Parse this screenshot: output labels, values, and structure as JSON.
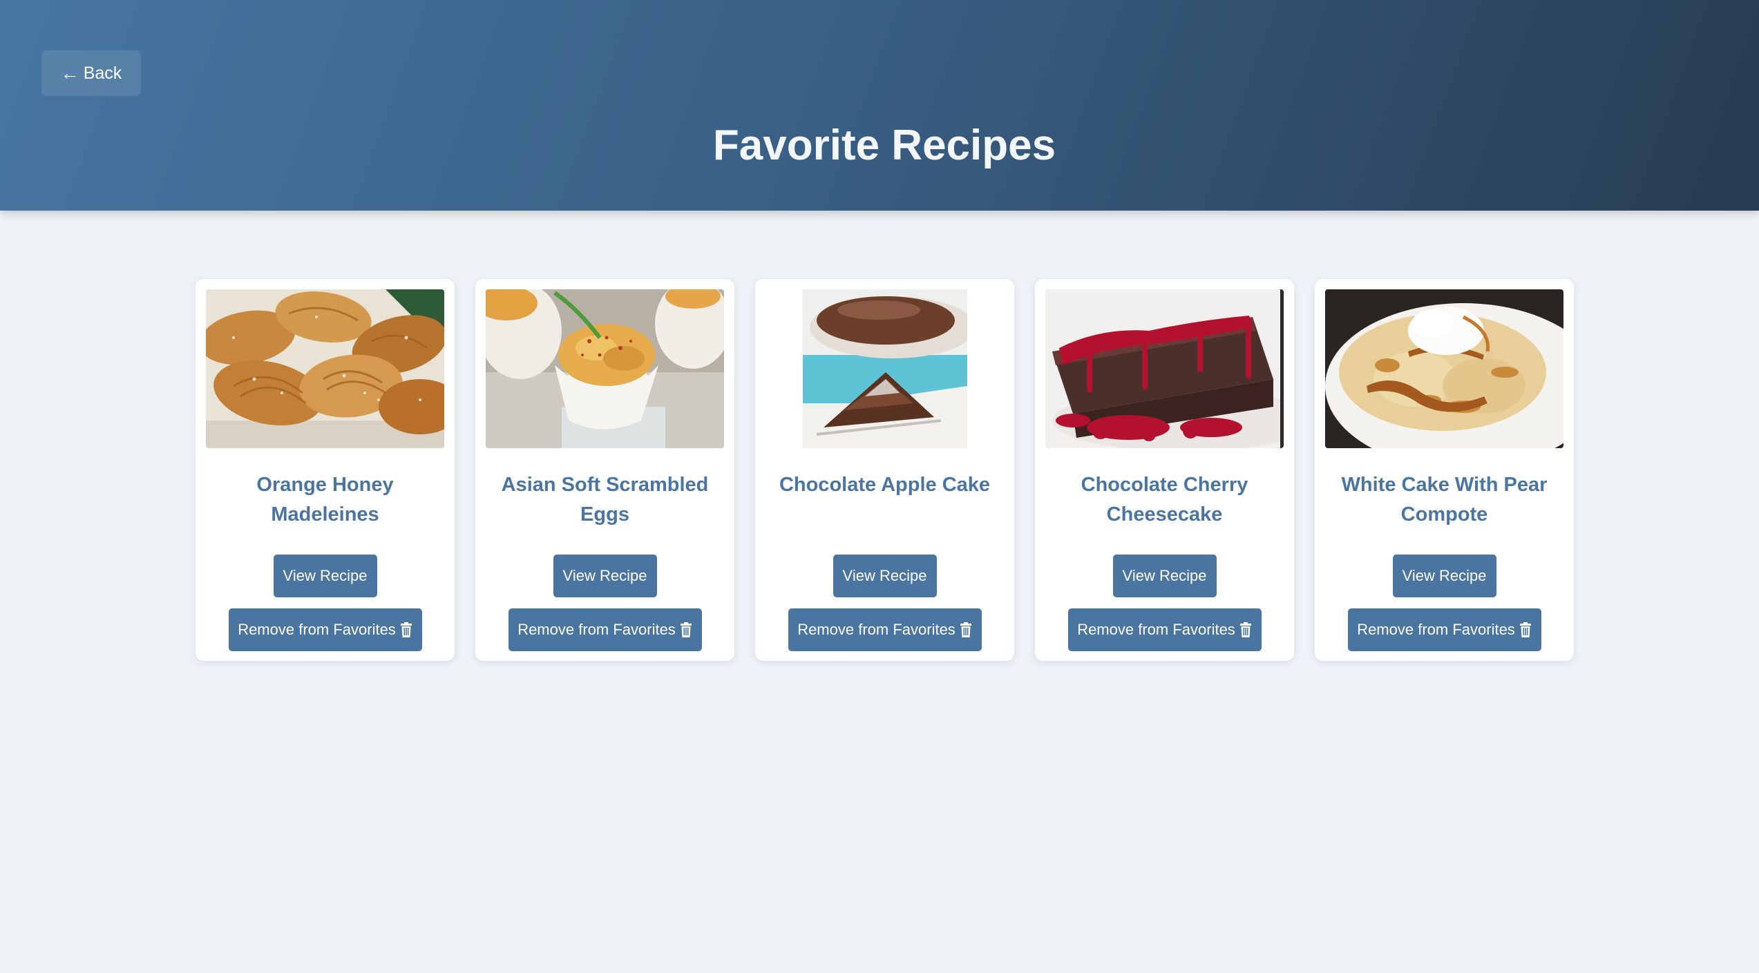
{
  "header": {
    "back_label": "Back",
    "back_icon": "left-arrow-icon",
    "title": "Favorite Recipes"
  },
  "colors": {
    "accent": "#4a75a0",
    "header_start": "#4776a2",
    "header_end": "#273c52",
    "background": "#eff2f7"
  },
  "recipes": [
    {
      "title": "Orange Honey Madeleines",
      "image": "madeleines-photo",
      "view_label": "View Recipe",
      "remove_label": "Remove from Favorites",
      "remove_icon": "trash-icon"
    },
    {
      "title": "Asian Soft Scrambled Eggs",
      "image": "scrambled-eggs-photo",
      "view_label": "View Recipe",
      "remove_label": "Remove from Favorites",
      "remove_icon": "trash-icon"
    },
    {
      "title": "Chocolate Apple Cake",
      "image": "chocolate-apple-cake-photo",
      "view_label": "View Recipe",
      "remove_label": "Remove from Favorites",
      "remove_icon": "trash-icon"
    },
    {
      "title": "Chocolate Cherry Cheesecake",
      "image": "cherry-cheesecake-photo",
      "view_label": "View Recipe",
      "remove_label": "Remove from Favorites",
      "remove_icon": "trash-icon"
    },
    {
      "title": "White Cake With Pear Compote",
      "image": "pear-compote-cake-photo",
      "view_label": "View Recipe",
      "remove_label": "Remove from Favorites",
      "remove_icon": "trash-icon"
    }
  ]
}
